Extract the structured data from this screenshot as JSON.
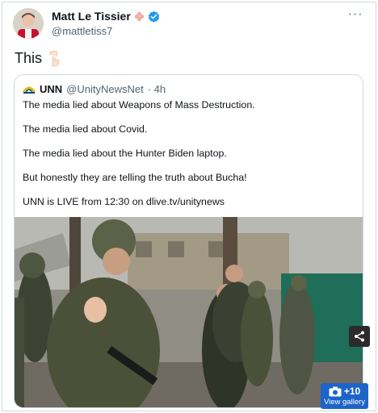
{
  "tweet": {
    "display_name": "Matt Le Tissier",
    "handle": "@mattletiss7",
    "text": "This",
    "emoji_icon": "pointing-down-hand-icon"
  },
  "quote": {
    "name": "UNN",
    "handle": "@UnityNewsNet",
    "time": "· 4h",
    "lines": [
      "The media lied about Weapons of Mass Destruction.",
      "The media lied about Covid.",
      "The media lied about the Hunter Biden laptop.",
      "But honestly they are telling the truth about Bucha!",
      "UNN is LIVE from 12:30 on dlive.tv/unitynews"
    ]
  },
  "gallery": {
    "count": "+10",
    "label": "View gallery"
  },
  "colors": {
    "text": "#0f1419",
    "muted": "#536471",
    "border": "#cfd9de",
    "verified": "#1d9bf0",
    "gallery_bg": "#1d64c9"
  }
}
